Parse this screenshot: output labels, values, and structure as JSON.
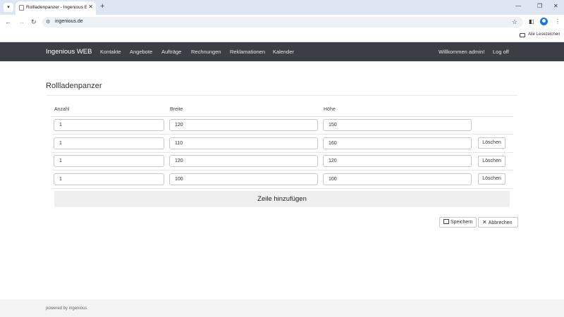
{
  "browser": {
    "tab_title": "Rollladenpanzer - Ingenious Er",
    "url": "ingenious.de",
    "bookmarks_label": "Alle Lesezeichen",
    "icons": {
      "tab_search": "chevron-down-icon",
      "favicon": "page-icon",
      "close": "close-icon",
      "new_tab": "plus-icon",
      "back": "arrow-left-icon",
      "forward": "arrow-right-icon",
      "reload": "reload-icon",
      "site_info": "tune-icon",
      "bookmark": "star-icon",
      "side_panel": "side-panel-icon",
      "profile": "profile-icon",
      "menu": "kebab-menu-icon",
      "folder": "folder-icon"
    }
  },
  "navbar": {
    "brand": "Ingenious WEB",
    "items": [
      "Kontakte",
      "Angebote",
      "Aufträge",
      "Rechnungen",
      "Reklamationen",
      "Kalender"
    ],
    "welcome": "Willkommen admin!",
    "logoff": "Log off"
  },
  "page": {
    "title": "Rollladenpanzer",
    "columns": [
      "Anzahl",
      "Breite",
      "Höhe"
    ],
    "rows": [
      {
        "anzahl": "1",
        "breite": "120",
        "hoehe": "150",
        "delete": ""
      },
      {
        "anzahl": "1",
        "breite": "110",
        "hoehe": "160",
        "delete": "Löschen"
      },
      {
        "anzahl": "1",
        "breite": "120",
        "hoehe": "120",
        "delete": "Löschen"
      },
      {
        "anzahl": "1",
        "breite": "100",
        "hoehe": "100",
        "delete": "Löschen"
      }
    ],
    "add_row": "Zeile hinzufügen",
    "save": "Speichern",
    "cancel": "Abbrechen"
  },
  "footer": {
    "text": "powered by ingenious"
  },
  "colors": {
    "navbar_bg": "#3b3f45",
    "tabstrip_bg": "#dfe6f3",
    "footer_bg": "#f3f3f3"
  }
}
